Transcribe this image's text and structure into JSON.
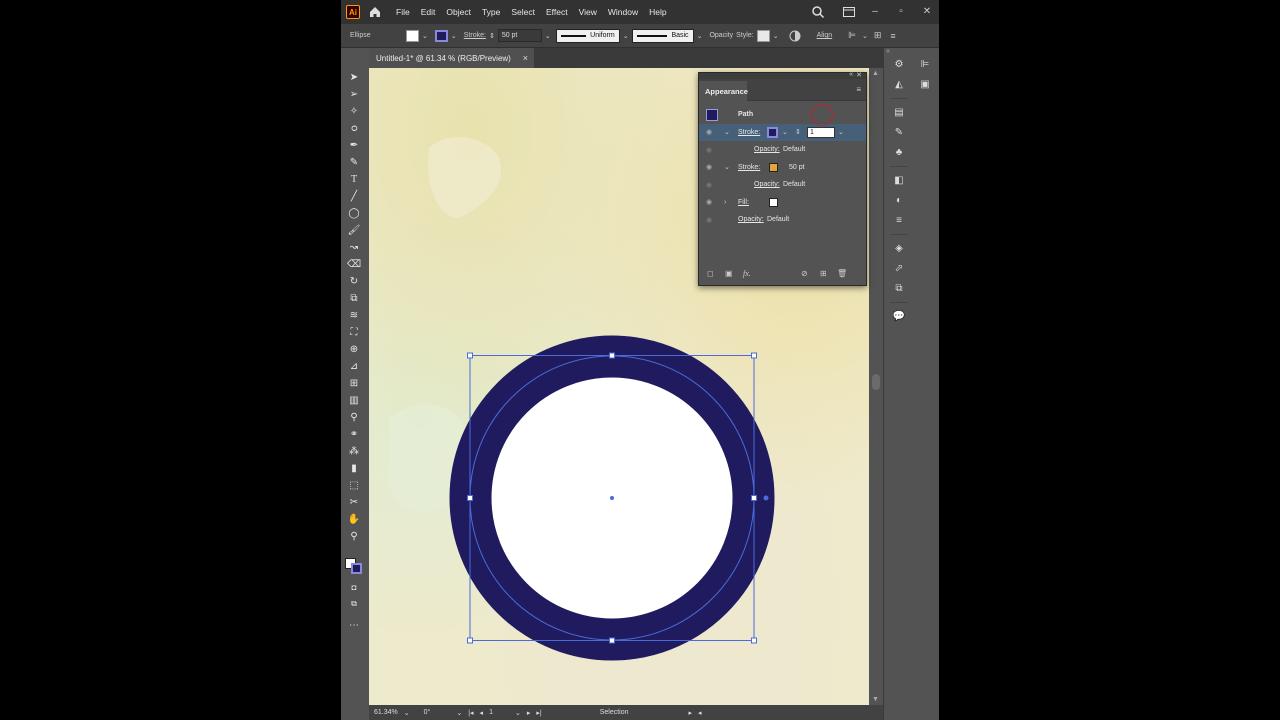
{
  "app": {
    "logo": "Ai"
  },
  "menu": [
    "File",
    "Edit",
    "Object",
    "Type",
    "Select",
    "Effect",
    "View",
    "Window",
    "Help"
  ],
  "control": {
    "object_type": "Ellipse",
    "stroke_label": "Stroke:",
    "stroke_weight": "50 pt",
    "profile": "Uniform",
    "brush": "Basic",
    "opacity_label": "Opacity",
    "style_label": "Style:",
    "align_label": "Align"
  },
  "document_tab": {
    "title": "Untitled-1* @ 61.34 % (RGB/Preview)",
    "close": "×"
  },
  "appearance": {
    "title": "Appearance",
    "path_label": "Path",
    "rows": [
      {
        "label": "Stroke:",
        "value": ""
      },
      {
        "label": "Opacity:",
        "value": "Default"
      },
      {
        "label": "Stroke:",
        "value": "50 pt"
      },
      {
        "label": "Opacity:",
        "value": "Default"
      },
      {
        "label": "Fill:",
        "value": ""
      },
      {
        "label": "Opacity:",
        "value": "Default"
      }
    ],
    "stroke_input": "1",
    "colors": {
      "stroke1": "#1f1b5e",
      "stroke2": "#e8a23a",
      "fill": "#ffffff",
      "path": "#1f1b5e"
    }
  },
  "status": {
    "zoom": "61.34%",
    "rotation": "0°",
    "artboard": "1",
    "tool": "Selection"
  },
  "colors": {
    "circle_stroke": "#1f1b5e",
    "selection": "#4a6bd8"
  }
}
